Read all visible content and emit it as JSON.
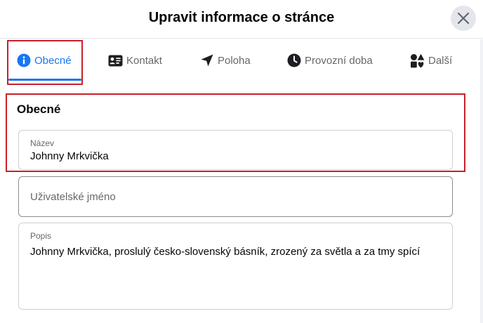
{
  "dialog": {
    "title": "Upravit informace o stránce"
  },
  "tabs": [
    {
      "label": "Obecné",
      "icon": "info-icon",
      "active": true
    },
    {
      "label": "Kontakt",
      "icon": "contact-card-icon",
      "active": false
    },
    {
      "label": "Poloha",
      "icon": "location-arrow-icon",
      "active": false
    },
    {
      "label": "Provozní doba",
      "icon": "clock-icon",
      "active": false
    },
    {
      "label": "Další",
      "icon": "shapes-icon",
      "active": false
    }
  ],
  "section": {
    "heading": "Obecné"
  },
  "fields": {
    "name": {
      "label": "Název",
      "value": "Johnny Mrkvička"
    },
    "username": {
      "placeholder": "Uživatelské jméno"
    },
    "description": {
      "label": "Popis",
      "value": "Johnny Mrkvička, proslulý česko-slovenský básník, zrozený za světla a za tmy spící"
    }
  },
  "colors": {
    "accent": "#1877f2",
    "highlight": "#c8202a",
    "text": "#050505",
    "secondary_text": "#65676b"
  }
}
